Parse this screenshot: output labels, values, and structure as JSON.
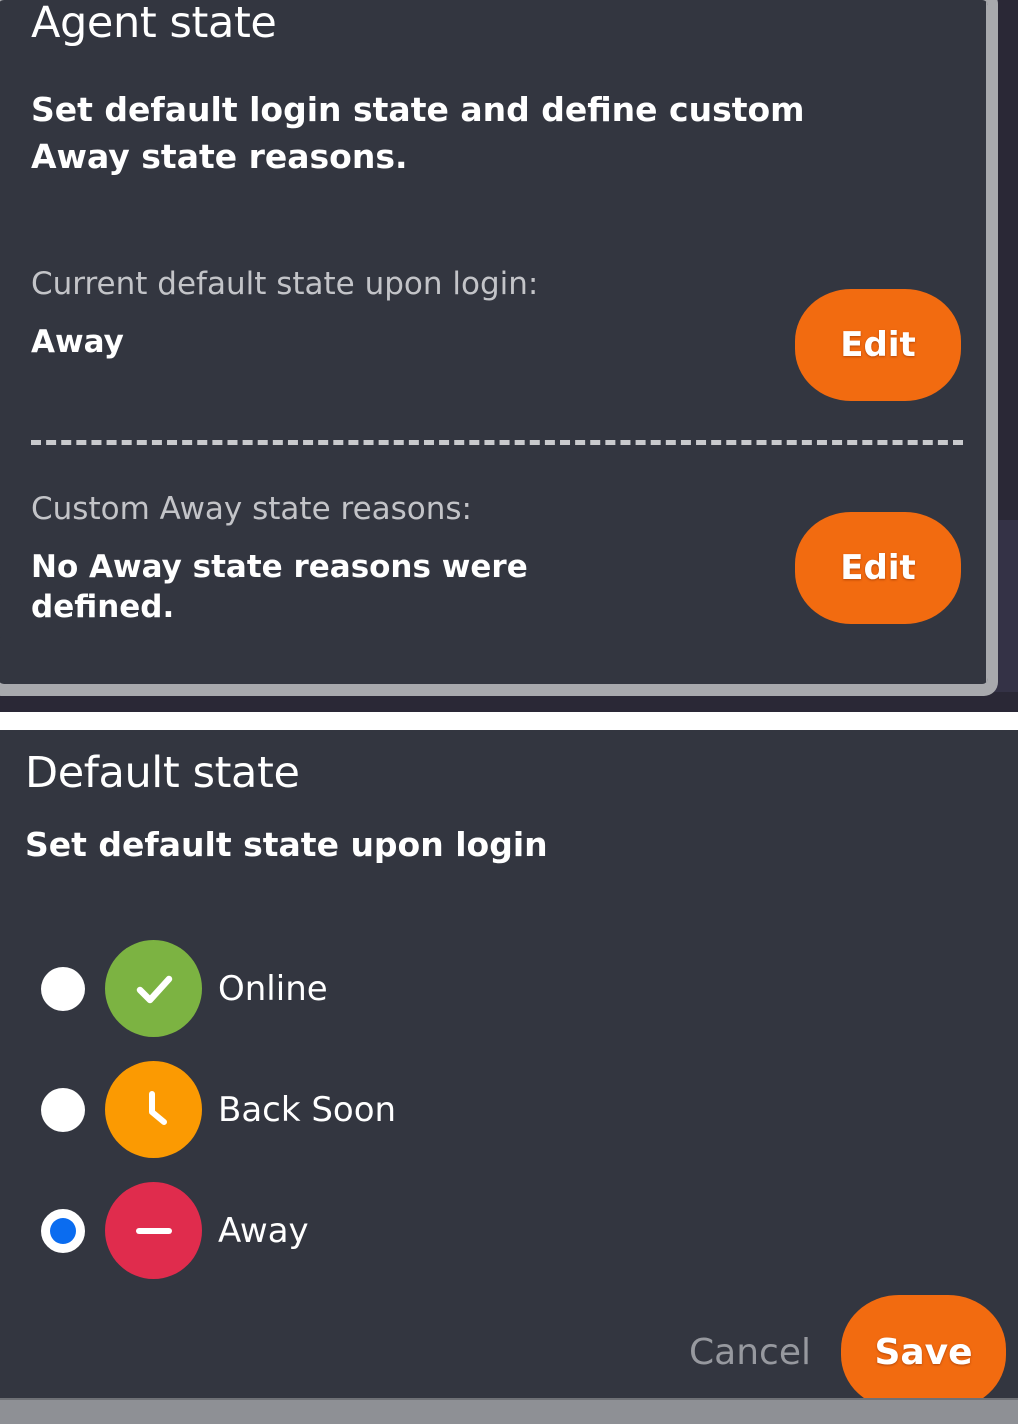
{
  "agent_state_card": {
    "title": "Agent state",
    "description": "Set default login state and define custom Away state reasons.",
    "rows": [
      {
        "label": "Current default state upon login:",
        "value": "Away",
        "action_label": "Edit"
      },
      {
        "label": "Custom Away state reasons:",
        "value": "No Away state reasons were defined.",
        "action_label": "Edit"
      }
    ]
  },
  "default_state_dialog": {
    "title": "Default state",
    "subtitle": "Set default state upon login",
    "options": [
      {
        "label": "Online",
        "icon": "check-circle-icon",
        "icon_color": "#7cb342",
        "selected": false
      },
      {
        "label": "Back Soon",
        "icon": "clock-circle-icon",
        "icon_color": "#fb9a02",
        "selected": false
      },
      {
        "label": "Away",
        "icon": "minus-circle-icon",
        "icon_color": "#e02c4d",
        "selected": true
      }
    ],
    "cancel_label": "Cancel",
    "save_label": "Save"
  },
  "colors": {
    "accent_orange": "#f26b10",
    "panel_dark": "#333640",
    "backdrop_navy": "#2a2836",
    "frame_silver": "#a8a9ad",
    "radio_selected_blue": "#0a6cf0",
    "muted_text": "#c3c4c8"
  }
}
